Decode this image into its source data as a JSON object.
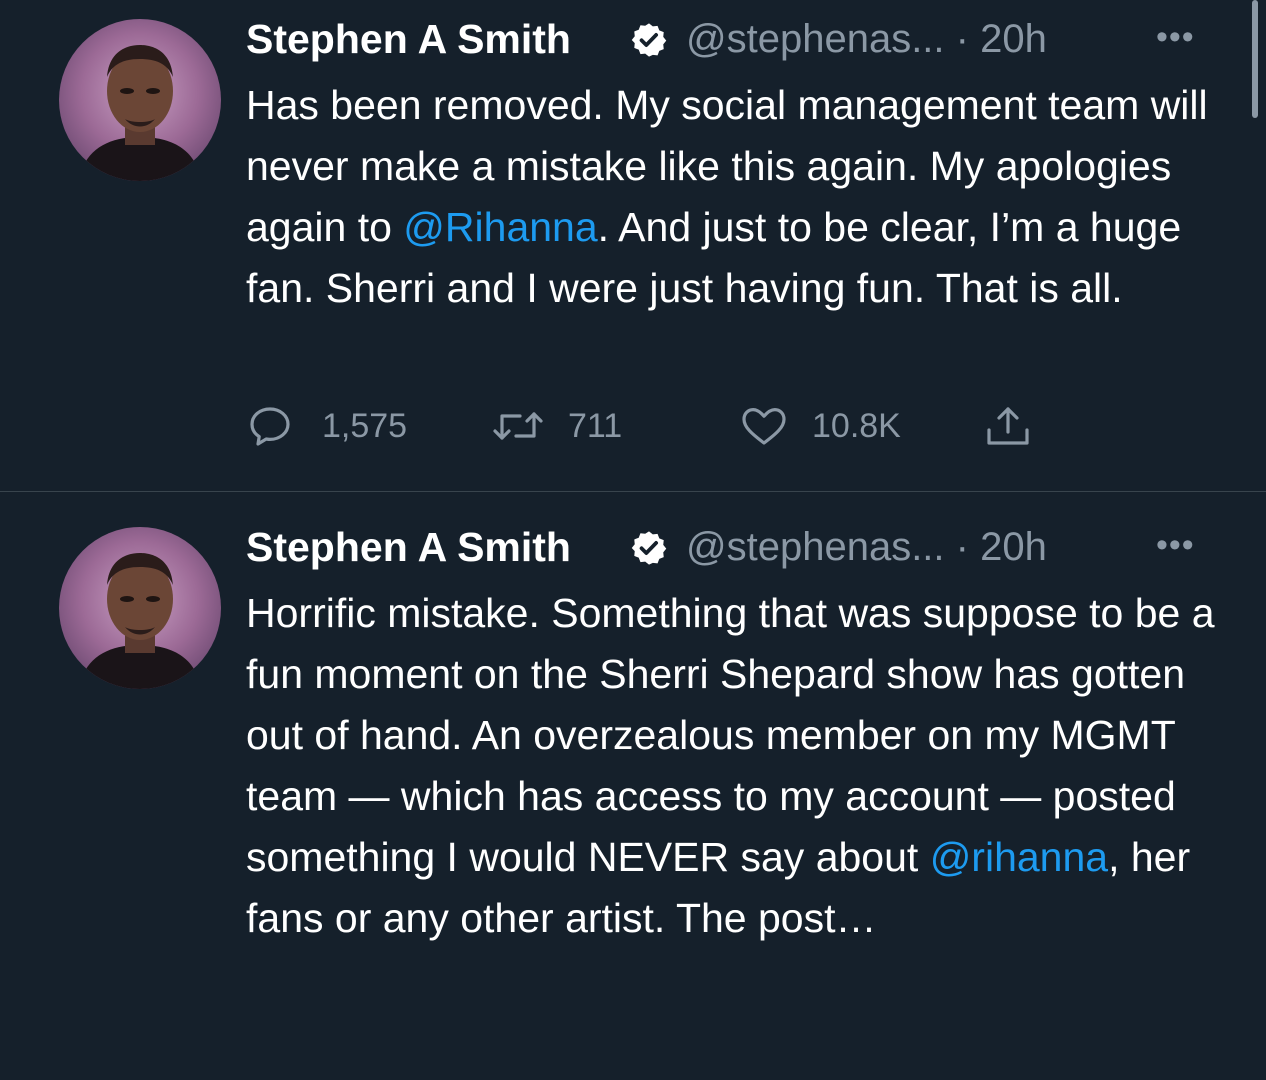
{
  "tweets": [
    {
      "author_name": "Stephen A Smith",
      "handle": "@stephenas...",
      "separator": "·",
      "time": "20h",
      "more": "•••",
      "text_parts": [
        "Has been removed. My social management team will never make a mistake like this again. My apologies again to ",
        "@Rihanna",
        ". And just to be clear, I’m a huge fan. Sherri and I were just having fun. That is all."
      ],
      "actions": {
        "replies": "1,575",
        "retweets": "711",
        "likes": "10.8K"
      }
    },
    {
      "author_name": "Stephen A Smith",
      "handle": "@stephenas...",
      "separator": "·",
      "time": "20h",
      "more": "•••",
      "text_parts": [
        "Horrific mistake. Something that was suppose to be a fun moment on the Sherri Shepard show has gotten out of hand. An overzealous member on my MGMT team — which has access to my account — posted something I would NEVER say about ",
        "@rihanna",
        ", her fans or any other artist. The post…"
      ]
    }
  ],
  "colors": {
    "background": "#15202b",
    "text": "#ffffff",
    "secondary_text": "#8b98a5",
    "link": "#1d9bf0",
    "divider": "#38444d"
  },
  "icons": {
    "verified": "verified-badge-icon",
    "reply": "reply-icon",
    "retweet": "retweet-icon",
    "like": "heart-icon",
    "share": "share-icon",
    "more": "more-options-icon"
  }
}
